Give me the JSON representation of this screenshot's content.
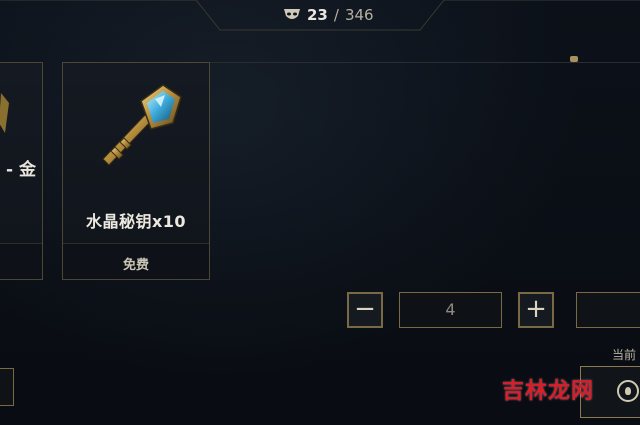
{
  "header": {
    "icon": "mask-icon",
    "current": "23",
    "separator": "/",
    "total": "346"
  },
  "cards": {
    "left": {
      "text": "- 金"
    },
    "main": {
      "icon": "crystal-key-icon",
      "name": "水晶秘钥x10",
      "price": "免费"
    }
  },
  "quantity": {
    "minus_label": "−",
    "value": "4",
    "plus_label": "+"
  },
  "footer": {
    "current_label": "当前",
    "currency_icon": "coin-icon"
  },
  "watermark": "吉林龙网",
  "colors": {
    "accent_gold": "#7a6a43",
    "background": "#0a0e15",
    "watermark_red": "#d81e2a"
  }
}
